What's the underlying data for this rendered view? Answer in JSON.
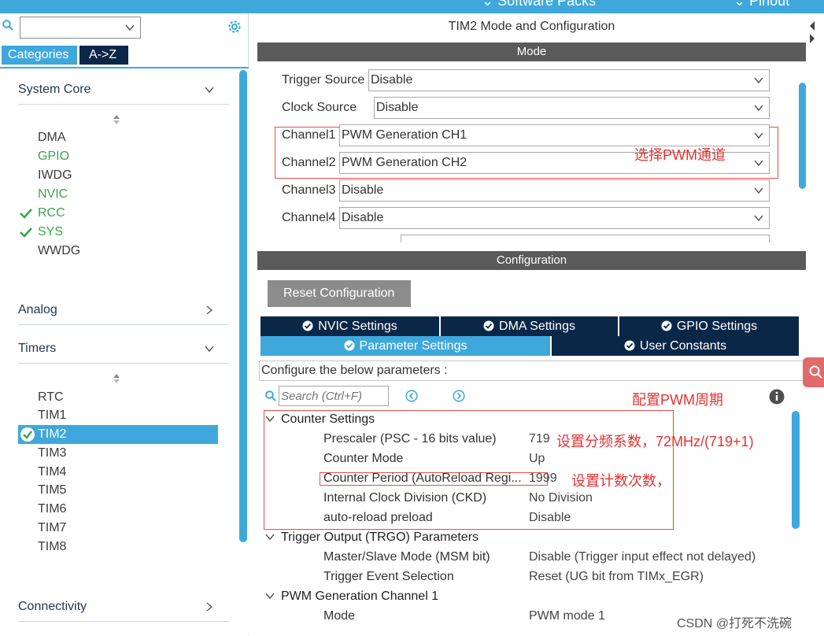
{
  "topbar": {
    "left_label": "Software Packs",
    "right_label": "Pinout"
  },
  "left": {
    "search_value": "",
    "tabs": [
      "Categories",
      "A->Z"
    ],
    "categories": [
      {
        "label": "System Core",
        "expanded": true,
        "items": [
          {
            "label": "DMA",
            "state": "normal"
          },
          {
            "label": "GPIO",
            "state": "green"
          },
          {
            "label": "IWDG",
            "state": "normal"
          },
          {
            "label": "NVIC",
            "state": "green"
          },
          {
            "label": "RCC",
            "state": "checked"
          },
          {
            "label": "SYS",
            "state": "checked"
          },
          {
            "label": "WWDG",
            "state": "normal"
          }
        ]
      },
      {
        "label": "Analog",
        "expanded": false
      },
      {
        "label": "Timers",
        "expanded": true,
        "items": [
          {
            "label": "RTC",
            "state": "normal"
          },
          {
            "label": "TIM1",
            "state": "normal"
          },
          {
            "label": "TIM2",
            "state": "selected"
          },
          {
            "label": "TIM3",
            "state": "normal"
          },
          {
            "label": "TIM4",
            "state": "normal"
          },
          {
            "label": "TIM5",
            "state": "normal"
          },
          {
            "label": "TIM6",
            "state": "normal"
          },
          {
            "label": "TIM7",
            "state": "normal"
          },
          {
            "label": "TIM8",
            "state": "normal"
          }
        ]
      },
      {
        "label": "Connectivity",
        "expanded": false
      }
    ]
  },
  "right": {
    "title": "TIM2 Mode and Configuration",
    "mode_bar": "Mode",
    "mode_rows": [
      {
        "label": "Trigger Source",
        "value": "Disable"
      },
      {
        "label": "Clock Source",
        "value": "Disable"
      },
      {
        "label": "Channel1",
        "value": "PWM Generation CH1"
      },
      {
        "label": "Channel2",
        "value": "PWM Generation CH2"
      },
      {
        "label": "Channel3",
        "value": "Disable"
      },
      {
        "label": "Channel4",
        "value": "Disable"
      }
    ],
    "mode_annotation": "选择PWM通道",
    "config_bar": "Configuration",
    "reset_button": "Reset Configuration",
    "tabs_row1": [
      "NVIC Settings",
      "DMA Settings",
      "GPIO Settings"
    ],
    "tabs_row2": [
      "Parameter Settings",
      "User Constants"
    ],
    "configure_text": "Configure the below parameters :",
    "search_placeholder": "Search (Ctrl+F)",
    "config_annotation": "配置PWM周期",
    "groups": [
      {
        "header": "Counter Settings",
        "params": [
          {
            "name": "Prescaler (PSC - 16 bits value)",
            "value": "719"
          },
          {
            "name": "Counter Mode",
            "value": "Up"
          },
          {
            "name": "Counter Period (AutoReload Regi...",
            "value": "1999"
          },
          {
            "name": "Internal Clock Division (CKD)",
            "value": "No Division"
          },
          {
            "name": "auto-reload preload",
            "value": "Disable"
          }
        ]
      },
      {
        "header": "Trigger Output (TRGO) Parameters",
        "params": [
          {
            "name": "Master/Slave Mode (MSM bit)",
            "value": "Disable (Trigger input effect not delayed)"
          },
          {
            "name": "Trigger Event Selection",
            "value": "Reset (UG bit from TIMx_EGR)"
          }
        ]
      },
      {
        "header": "PWM Generation Channel 1",
        "params": [
          {
            "name": "Mode",
            "value": "PWM mode 1"
          }
        ]
      }
    ],
    "annotation_prescaler": "设置分频系数，72MHz/(719+1)",
    "annotation_period": "设置计数次数，"
  },
  "watermark": "CSDN @打死不洗碗",
  "colors": {
    "accent": "#3ea8dc",
    "navy": "#0b2747",
    "green": "#3aa64e",
    "annotation_red": "#e8302f"
  }
}
